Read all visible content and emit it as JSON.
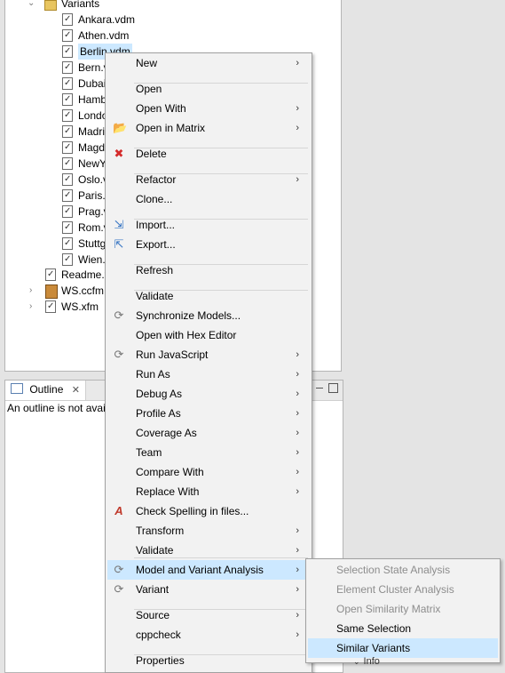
{
  "explorer": {
    "folder_label": "Variants",
    "files": [
      "Ankara.vdm",
      "Athen.vdm",
      "Berlin.vdm",
      "Bern.v",
      "Dubai",
      "Hamb",
      "Londo",
      "Madri",
      "Magd",
      "NewY",
      "Oslo.v",
      "Paris.v",
      "Prag.v",
      "Rom.v",
      "Stuttg",
      "Wien."
    ],
    "other": [
      "Readme.t",
      "WS.ccfm",
      "WS.xfm"
    ]
  },
  "outline": {
    "tab_label": "Outline",
    "message": "An outline is not avai"
  },
  "context_menu": {
    "items": [
      {
        "label": "New",
        "submenu": true
      },
      {
        "label": "Open",
        "submenu": false
      },
      {
        "label": "Open With",
        "submenu": true
      },
      {
        "label": "Open in Matrix",
        "submenu": true,
        "icon": "open-matrix-icon"
      },
      {
        "label": "Delete",
        "submenu": false,
        "icon": "delete-icon"
      },
      {
        "label": "Refactor",
        "submenu": true
      },
      {
        "label": "Clone...",
        "submenu": false
      },
      {
        "label": "Import...",
        "submenu": false,
        "icon": "import-icon"
      },
      {
        "label": "Export...",
        "submenu": false,
        "icon": "export-icon"
      },
      {
        "label": "Refresh",
        "submenu": false
      },
      {
        "label": "Validate",
        "submenu": false
      },
      {
        "label": "Synchronize Models...",
        "submenu": false,
        "icon": "sync-icon"
      },
      {
        "label": "Open with Hex Editor",
        "submenu": false
      },
      {
        "label": "Run JavaScript",
        "submenu": true,
        "icon": "run-js-icon"
      },
      {
        "label": "Run As",
        "submenu": true
      },
      {
        "label": "Debug As",
        "submenu": true
      },
      {
        "label": "Profile As",
        "submenu": true
      },
      {
        "label": "Coverage As",
        "submenu": true
      },
      {
        "label": "Team",
        "submenu": true
      },
      {
        "label": "Compare With",
        "submenu": true
      },
      {
        "label": "Replace With",
        "submenu": true
      },
      {
        "label": "Check Spelling in files...",
        "submenu": false,
        "icon": "spelling-icon"
      },
      {
        "label": "Transform",
        "submenu": true
      },
      {
        "label": "Validate",
        "submenu": true
      },
      {
        "label": "Model and Variant Analysis",
        "submenu": true,
        "icon": "analysis-icon"
      },
      {
        "label": "Variant",
        "submenu": true,
        "icon": "variant-icon"
      },
      {
        "label": "Source",
        "submenu": true
      },
      {
        "label": "cppcheck",
        "submenu": true
      },
      {
        "label": "Properties",
        "submenu": false
      }
    ]
  },
  "submenu": {
    "items": [
      {
        "label": "Selection State Analysis",
        "enabled": false
      },
      {
        "label": "Element Cluster Analysis",
        "enabled": false
      },
      {
        "label": "Open Similarity Matrix",
        "enabled": false
      },
      {
        "label": "Same Selection",
        "enabled": true
      },
      {
        "label": "Similar Variants",
        "enabled": true
      }
    ]
  },
  "partial_right_label": "Info",
  "colors": {
    "highlight": "#cce8ff",
    "menu_bg": "#f2f2f2",
    "disabled_text": "#8d8d8d"
  }
}
